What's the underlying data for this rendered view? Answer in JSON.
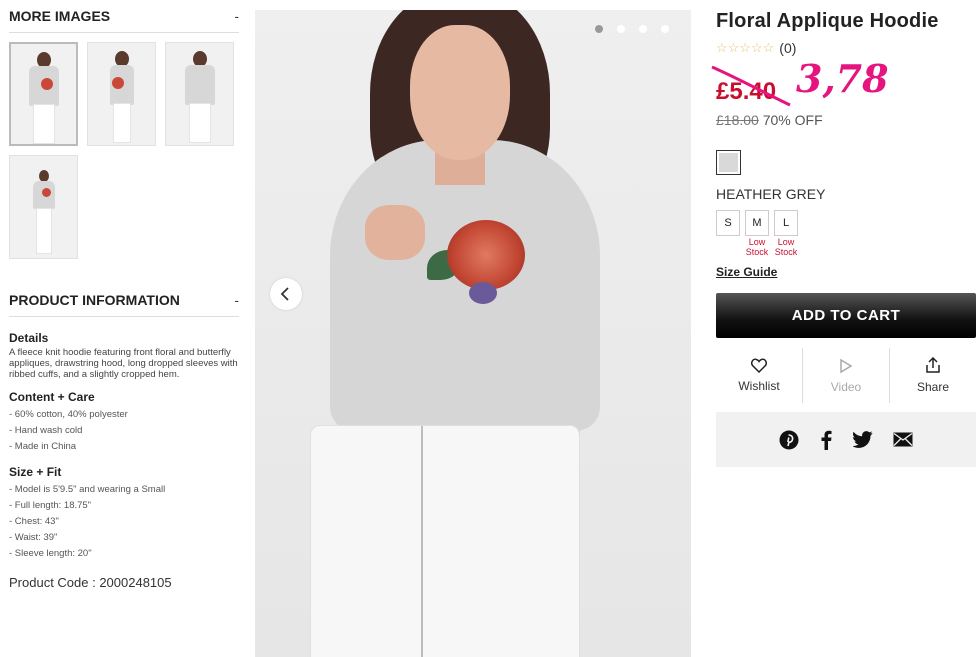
{
  "left": {
    "more_images_title": "MORE IMAGES",
    "more_images_toggle": "-",
    "product_info_title": "PRODUCT INFORMATION",
    "product_info_toggle": "-",
    "details_title": "Details",
    "details_text": "A fleece knit hoodie featuring front floral and butterfly appliques, drawstring hood, long dropped sleeves with ribbed cuffs, and a slightly cropped hem.",
    "content_title": "Content + Care",
    "content_items": [
      "- 60% cotton, 40% polyester",
      "- Hand wash cold",
      "- Made in China"
    ],
    "size_title": "Size + Fit",
    "size_items": [
      "- Model is 5'9.5\" and wearing a Small",
      "- Full length: 18.75\"",
      "- Chest: 43\"",
      "- Waist: 39\"",
      "- Sleeve length: 20\""
    ],
    "product_code": "Product Code : 2000248105"
  },
  "product": {
    "title": "Floral Applique Hoodie",
    "rating_count": "(0)",
    "sale_price": "£5.40",
    "handwritten_price": "3,78",
    "original_price": "£18.00",
    "discount": "70% OFF",
    "color_name": "HEATHER GREY",
    "sizes": [
      {
        "label": "S",
        "note": ""
      },
      {
        "label": "M",
        "note": "Low Stock"
      },
      {
        "label": "L",
        "note": "Low Stock"
      }
    ],
    "size_guide": "Size Guide",
    "add_to_cart": "ADD TO CART",
    "wishlist": "Wishlist",
    "video": "Video",
    "share": "Share"
  },
  "colors": {
    "sale_red": "#c8102e",
    "handwritten_pink": "#e4157e",
    "swatch_grey": "#d9d9d9"
  }
}
